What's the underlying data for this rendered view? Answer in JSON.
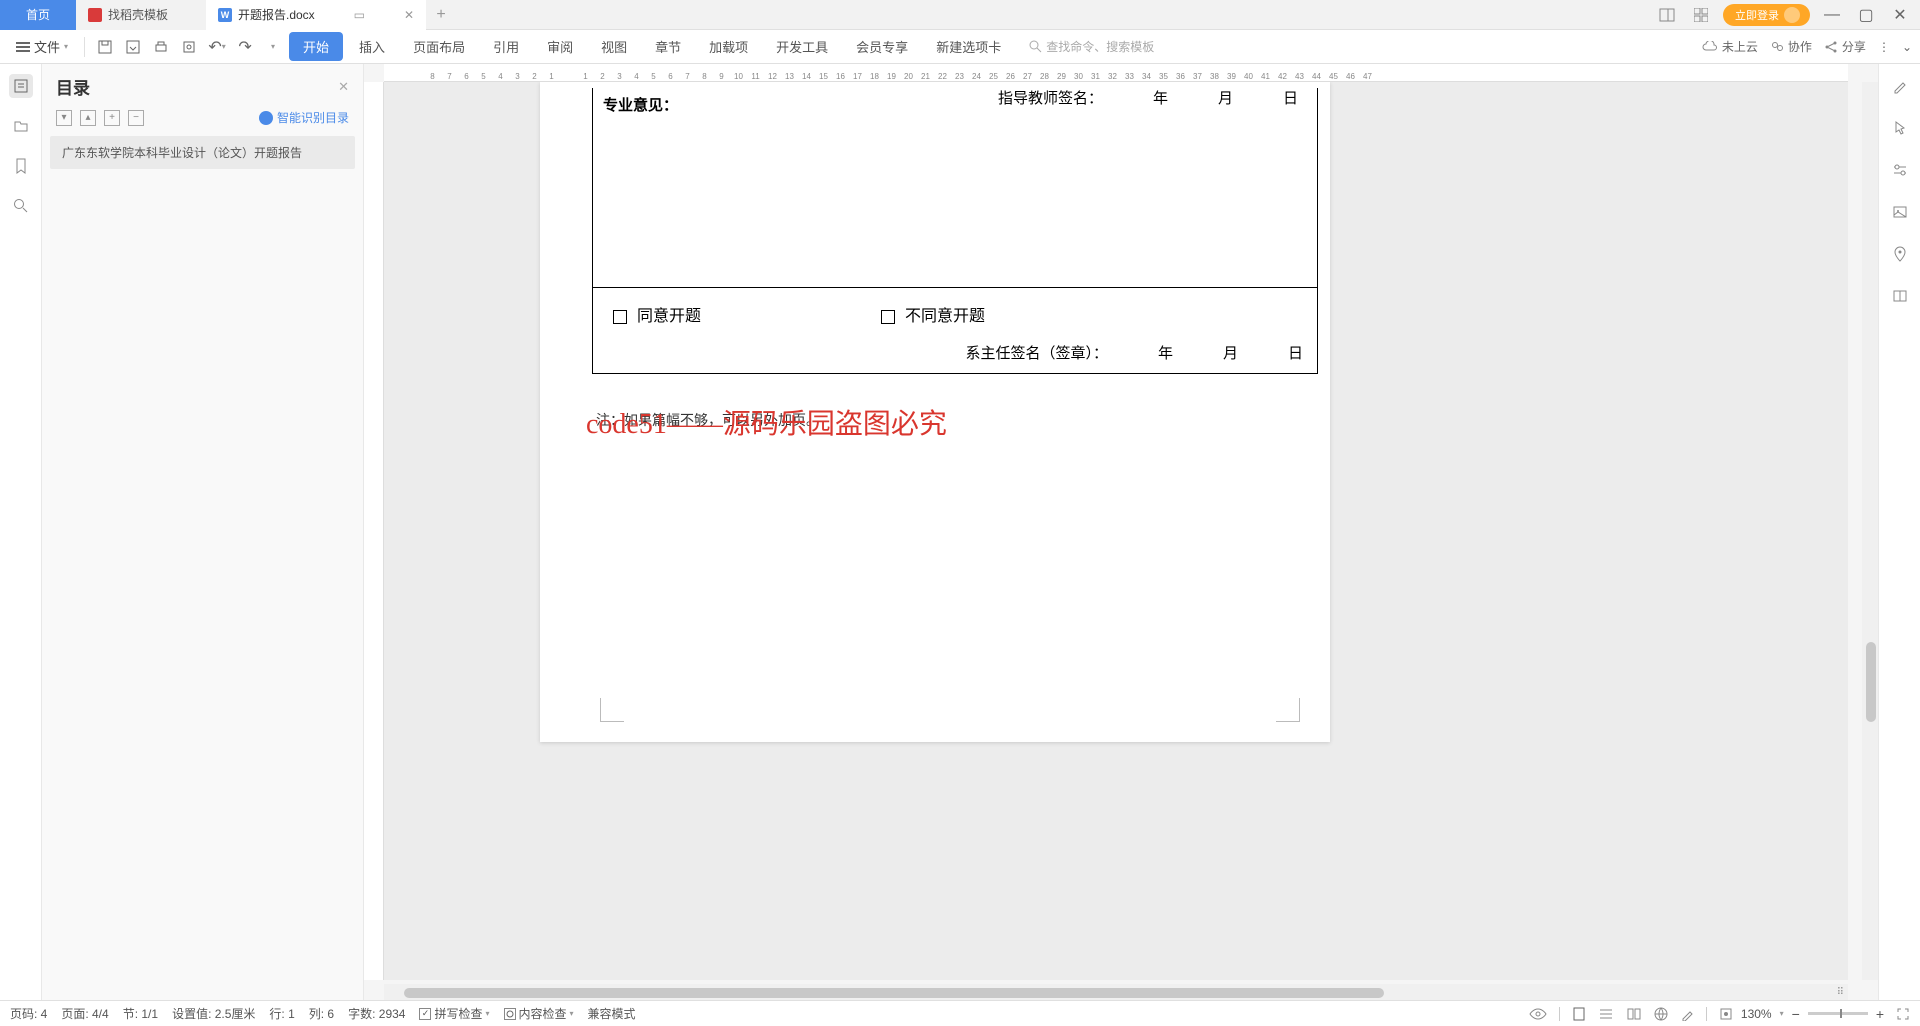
{
  "tabs": {
    "home": "首页",
    "template": "找稻壳模板",
    "active": "开题报告.docx"
  },
  "login_button": "立即登录",
  "file_menu": "文件",
  "ribbon": {
    "start": "开始",
    "insert": "插入",
    "layout": "页面布局",
    "reference": "引用",
    "review": "审阅",
    "view": "视图",
    "chapter": "章节",
    "addon": "加载项",
    "dev": "开发工具",
    "member": "会员专享",
    "newtab": "新建选项卡"
  },
  "search_placeholder": "查找命令、搜索模板",
  "top_right": {
    "cloud": "未上云",
    "collab": "协作",
    "share": "分享"
  },
  "sidebar": {
    "title": "目录",
    "smart": "智能识别目录",
    "item": "广东东软学院本科毕业设计（论文）开题报告"
  },
  "document": {
    "top_sig_label": "指导教师签名：",
    "opinion_label": "专业意见：",
    "agree": "同意开题",
    "disagree": "不同意开题",
    "dean_sig": "系主任签名（签章）：",
    "year": "年",
    "month": "月",
    "day": "日",
    "note": "注：如果篇幅不够，可以另外加页。",
    "watermark": "code51——源码乐园盗图必究"
  },
  "ruler_numbers": [
    "8",
    "7",
    "6",
    "5",
    "4",
    "3",
    "2",
    "1",
    "",
    "1",
    "2",
    "3",
    "4",
    "5",
    "6",
    "7",
    "8",
    "9",
    "10",
    "11",
    "12",
    "13",
    "14",
    "15",
    "16",
    "17",
    "18",
    "19",
    "20",
    "21",
    "22",
    "23",
    "24",
    "25",
    "26",
    "27",
    "28",
    "29",
    "30",
    "31",
    "32",
    "33",
    "34",
    "35",
    "36",
    "37",
    "38",
    "39",
    "40",
    "41",
    "42",
    "43",
    "44",
    "45",
    "46",
    "47"
  ],
  "status": {
    "page_no": "页码: 4",
    "page": "页面: 4/4",
    "section": "节: 1/1",
    "setting": "设置值: 2.5厘米",
    "row": "行: 1",
    "col": "列: 6",
    "words": "字数: 2934",
    "spell": "拼写检查",
    "content": "内容检查",
    "compat": "兼容模式",
    "zoom": "130%"
  }
}
